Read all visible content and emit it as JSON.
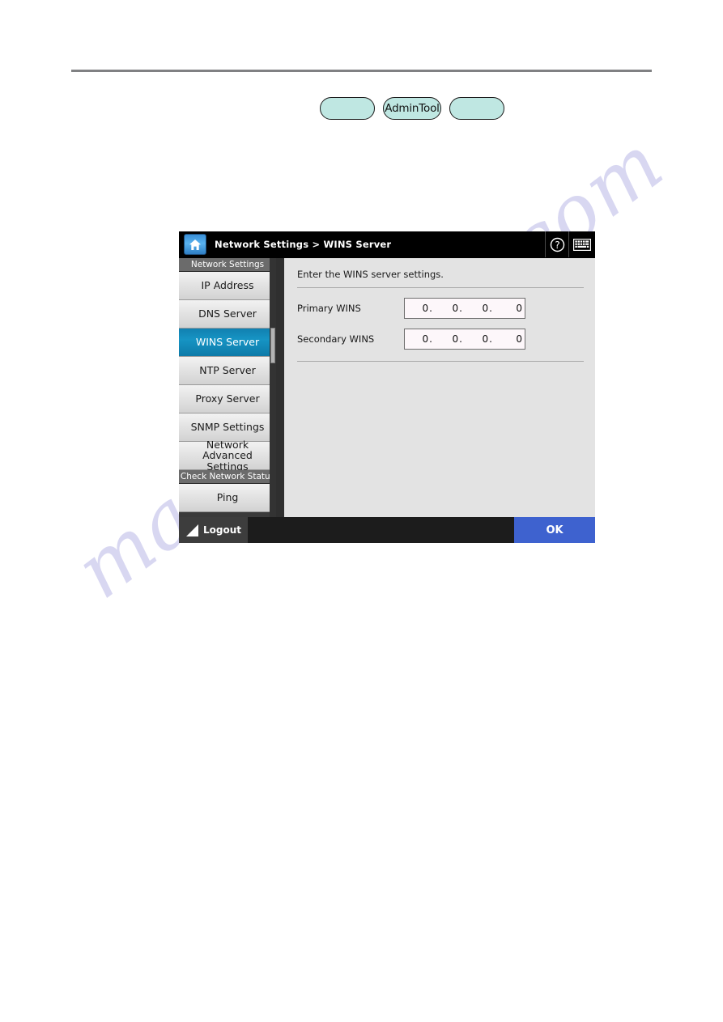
{
  "chips": [
    {
      "label": "",
      "name": "chip-blank-left"
    },
    {
      "label": "AdminTool",
      "name": "chip-admintool"
    },
    {
      "label": "",
      "name": "chip-blank-right"
    }
  ],
  "watermark": {
    "text": "manualshive.com"
  },
  "device": {
    "header": {
      "home_icon": "home-icon",
      "breadcrumb": "Network Settings  >  WINS Server",
      "help_icon": "?",
      "keyboard_icon": "keyboard-icon"
    },
    "sidebar": {
      "groups": [
        {
          "title": "Network Settings",
          "items": [
            {
              "label": "IP Address",
              "selected": false
            },
            {
              "label": "DNS Server",
              "selected": false
            },
            {
              "label": "WINS Server",
              "selected": true
            },
            {
              "label": "NTP Server",
              "selected": false
            },
            {
              "label": "Proxy Server",
              "selected": false
            },
            {
              "label": "SNMP Settings",
              "selected": false
            },
            {
              "label": "Network Advanced Settings",
              "selected": false
            }
          ]
        },
        {
          "title": "Check Network Status",
          "items": [
            {
              "label": "Ping",
              "selected": false
            }
          ]
        }
      ]
    },
    "content": {
      "instruction": "Enter the WINS server settings.",
      "fields": [
        {
          "label": "Primary WINS",
          "octets": [
            "0",
            "0",
            "0",
            "0"
          ]
        },
        {
          "label": "Secondary WINS",
          "octets": [
            "0",
            "0",
            "0",
            "0"
          ]
        }
      ]
    },
    "footer": {
      "logout_label": "Logout",
      "ok_label": "OK"
    }
  },
  "colors": {
    "accent_selected": "#1694c4",
    "ok_button": "#3e62cf",
    "chip_fill": "#bfe7e2",
    "panel_bg": "#e3e3e3"
  }
}
